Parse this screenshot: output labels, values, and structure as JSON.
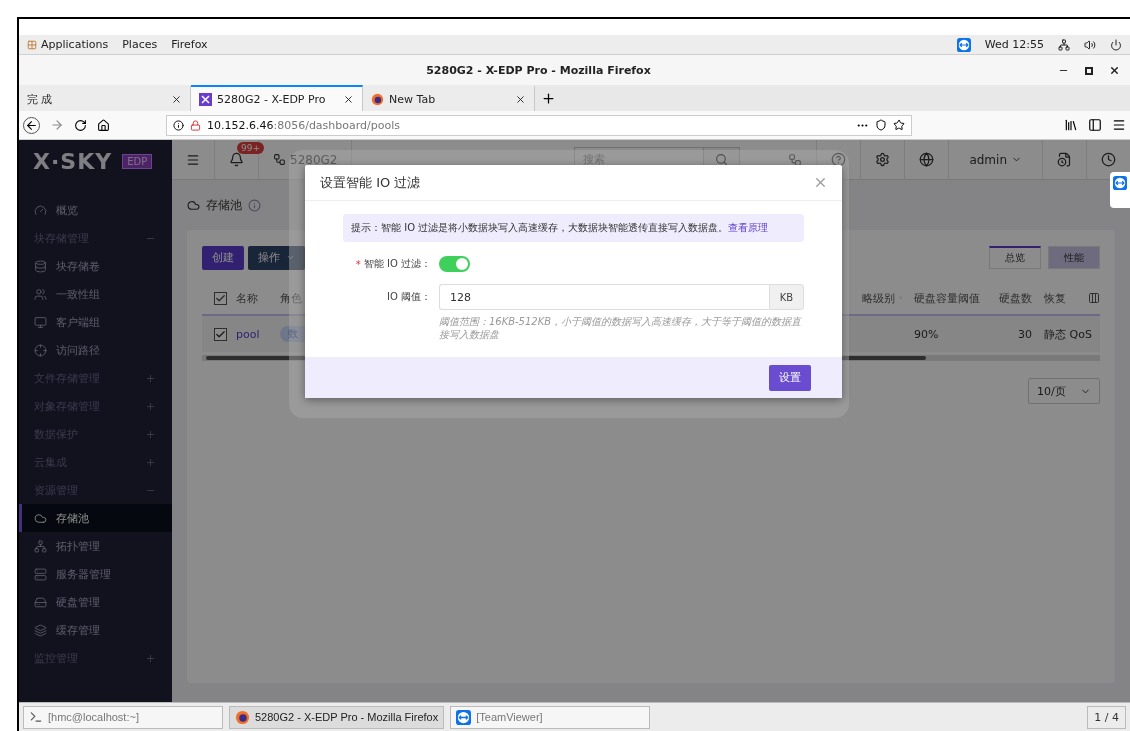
{
  "desktop_bar": {
    "menus": [
      "Applications",
      "Places",
      "Firefox"
    ],
    "clock": "Wed 12:55"
  },
  "window": {
    "title": "5280G2 - X-EDP Pro - Mozilla Firefox",
    "tabs": [
      {
        "label": "完 成",
        "selected": false
      },
      {
        "label": "5280G2 - X-EDP Pro",
        "selected": true
      },
      {
        "label": "New Tab",
        "selected": false
      }
    ],
    "url": {
      "host": "10.152.6.46",
      "path": ":8056/dashboard/pools"
    }
  },
  "app": {
    "logo": "X·SKY",
    "edition": "EDP",
    "sidebar": [
      {
        "kind": "link",
        "label": "概览",
        "selected": false
      },
      {
        "kind": "group",
        "label": "块存储管理",
        "expanded": true,
        "children": [
          {
            "kind": "link",
            "label": "块存储卷",
            "selected": false
          },
          {
            "kind": "link",
            "label": "一致性组",
            "selected": false
          },
          {
            "kind": "link",
            "label": "客户端组",
            "selected": false
          },
          {
            "kind": "link",
            "label": "访问路径",
            "selected": false
          }
        ]
      },
      {
        "kind": "group",
        "label": "文件存储管理",
        "expanded": false
      },
      {
        "kind": "group",
        "label": "对象存储管理",
        "expanded": false
      },
      {
        "kind": "group",
        "label": "数据保护",
        "expanded": false
      },
      {
        "kind": "group",
        "label": "云集成",
        "expanded": false
      },
      {
        "kind": "group",
        "label": "资源管理",
        "expanded": true,
        "children": [
          {
            "kind": "link",
            "label": "存储池",
            "selected": true
          },
          {
            "kind": "link",
            "label": "拓扑管理",
            "selected": false
          },
          {
            "kind": "link",
            "label": "服务器管理",
            "selected": false
          },
          {
            "kind": "link",
            "label": "硬盘管理",
            "selected": false
          },
          {
            "kind": "link",
            "label": "缓存管理",
            "selected": false
          }
        ]
      },
      {
        "kind": "group",
        "label": "监控管理",
        "expanded": false
      }
    ],
    "header": {
      "notifications": "99+",
      "cluster": "5280G2",
      "search_placeholder": "搜索",
      "user": "admin"
    },
    "breadcrumb": "存储池",
    "buttons": [
      {
        "label": "创建",
        "kind": "primary"
      },
      {
        "label": "操作",
        "kind": "dropdown"
      }
    ],
    "view_tabs": [
      {
        "label": "总览",
        "selected": true
      },
      {
        "label": "性能",
        "selected": false
      }
    ],
    "table": {
      "left_columns": [
        "名称",
        "角色"
      ],
      "right_columns": [
        "略级别",
        "硬盘容量阈值",
        "硬盘数",
        "恢复"
      ],
      "rows": [
        {
          "checked": true,
          "name": "pool",
          "role": "数",
          "strategy": "",
          "threshold": "90%",
          "disks": "30",
          "recovery": "静态 QoS"
        }
      ],
      "header_checked": true
    },
    "page_size": "10/页"
  },
  "dialog": {
    "title": "设置智能 IO 过滤",
    "hint": "提示：智能 IO 过滤是将小数据块写入高速缓存，大数据块智能透传直接写入数据盘。",
    "hint_link": "查看原理",
    "filter_label": "智能 IO 过滤：",
    "required_mark": "*",
    "filter_on": true,
    "threshold_label": "IO 阈值：",
    "threshold_value": "128",
    "threshold_unit": "KB",
    "help": "阈值范围：16KB-512KB，小于阈值的数据写入高速缓存，大于等于阈值的数据直接写入数据盘",
    "submit": "设置"
  },
  "taskbar": {
    "items": [
      {
        "label": "[hmc@localhost:~]",
        "selected": false
      },
      {
        "label": "5280G2 - X-EDP Pro - Mozilla Firefox",
        "selected": true
      },
      {
        "label": "[TeamViewer]",
        "selected": false
      }
    ],
    "workspace": "1 / 4"
  }
}
